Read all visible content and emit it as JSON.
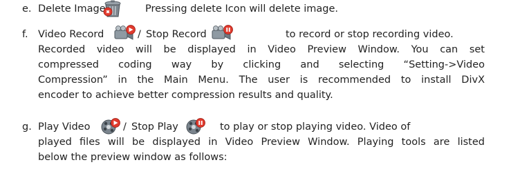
{
  "items": [
    {
      "marker": "e.",
      "label": "Delete Image",
      "icon": "trash-can-icon",
      "description": "Pressing delete Icon will delete image."
    },
    {
      "marker": "f.",
      "label1": "Video Record",
      "icon1": "video-record-icon",
      "separator": "/",
      "label2": "Stop Record",
      "icon2": "stop-record-icon",
      "line1_tail": "to record or stop recording video.",
      "lines": [
        "Recorded video will be displayed in Video Preview Window. You can set",
        "compressed coding way by clicking and selecting “Setting->Video",
        "Compression” in the Main Menu. The user is recommended to install DivX",
        "encoder to achieve better compression results and quality."
      ]
    },
    {
      "marker": "g.",
      "label1": "Play Video",
      "icon1": "play-video-icon",
      "separator": "/",
      "label2": "Stop Play",
      "icon2": "stop-play-icon",
      "line1_tail": "to play or stop playing video. Video of",
      "lines": [
        "played files will be displayed in Video Preview Window. Playing tools are listed",
        "below the preview window as follows:"
      ]
    }
  ]
}
